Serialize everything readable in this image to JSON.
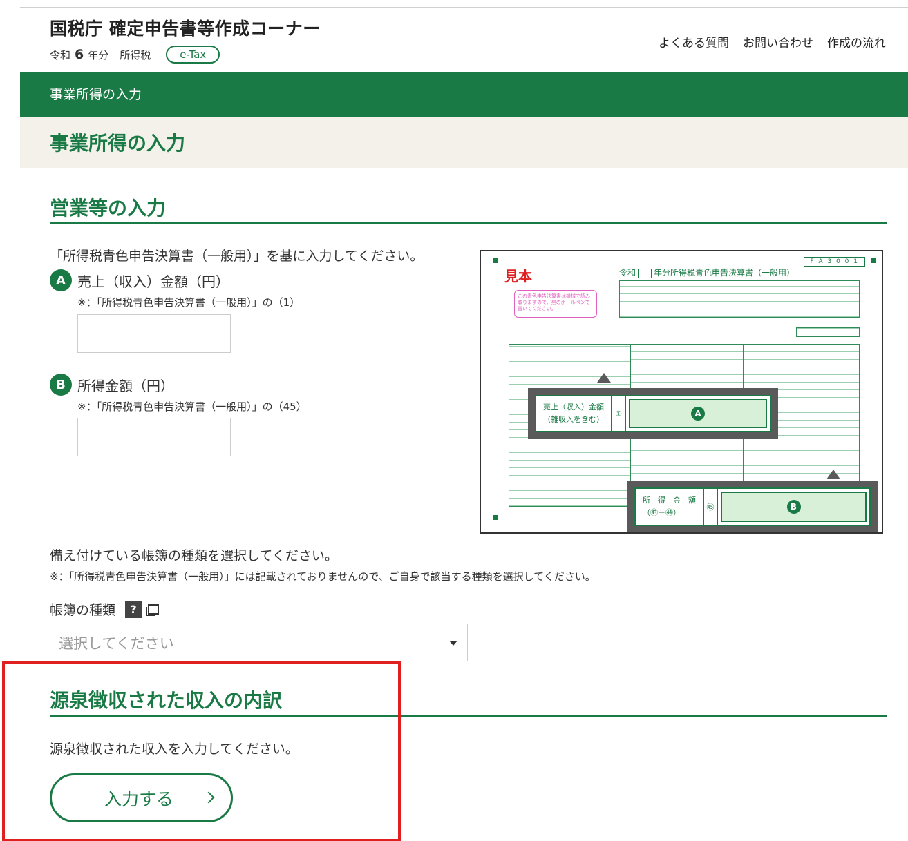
{
  "header": {
    "site_title": "国税庁 確定申告書等作成コーナー",
    "era": "令和",
    "year": "6",
    "year_suffix": "年分",
    "tax_type": "所得税",
    "etax_badge": "e-Tax",
    "links": [
      "よくある質問",
      "お問い合わせ",
      "作成の流れ"
    ]
  },
  "breadcrumb": {
    "label": "事業所得の入力"
  },
  "page": {
    "title": "事業所得の入力"
  },
  "section_sales": {
    "title": "営業等の入力",
    "lead": "「所得税青色申告決算書（一般用）」を基に入力してください。",
    "field_a": {
      "marker": "A",
      "label": "売上（収入）金額（円）",
      "note": "※：「所得税青色申告決算書（一般用）」の（1）",
      "value": ""
    },
    "field_b": {
      "marker": "B",
      "label": "所得金額（円）",
      "note": "※：「所得税青色申告決算書（一般用）」の（45）",
      "value": ""
    }
  },
  "sample_form": {
    "stamp": "見本",
    "form_code": "F A 3 0 0 1",
    "title_prefix": "令和",
    "title_suffix": "年分所得税青色申告決算書（一般用）",
    "note": "この青色申告決算書は機械で読み取りますので、黒のボールペンで書いてください。",
    "callout_a": {
      "label_line1": "売上（収入）金額",
      "label_line2": "（雑収入を含む）",
      "number": "①",
      "marker": "A"
    },
    "callout_b": {
      "label_line1": "所　得　金　額",
      "label_line2": "（㊸－㊹）",
      "number": "㊺",
      "marker": "B"
    }
  },
  "books": {
    "lead": "備え付けている帳簿の種類を選択してください。",
    "note": "※：「所得税青色申告決算書（一般用）」には記載されておりませんので、ご自身で該当する種類を選択してください。",
    "label": "帳簿の種類",
    "help": "?",
    "select_placeholder": "選択してください"
  },
  "withholding": {
    "title": "源泉徴収された収入の内訳",
    "lead": "源泉徴収された収入を入力してください。",
    "button_label": "入力する"
  },
  "colors": {
    "brand_green": "#1a7a45",
    "highlight_red": "#e0201f",
    "beige": "#f3f1ea"
  }
}
